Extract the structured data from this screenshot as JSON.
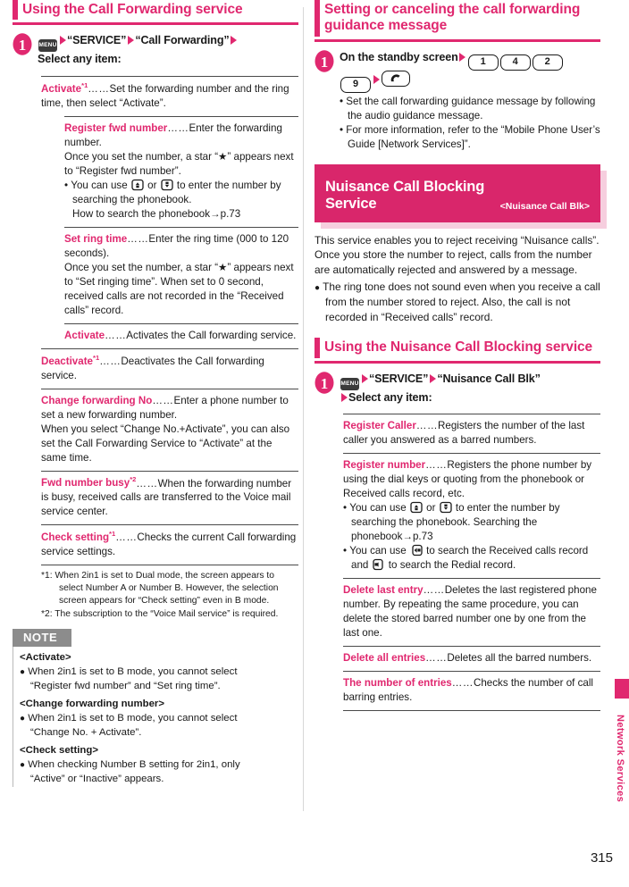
{
  "page": {
    "number": "315",
    "side_tab_label": "Network Services"
  },
  "left_column": {
    "section_heading": "Using the Call Forwarding service",
    "step": {
      "number_icon": "circled-number-1",
      "menu_key": "MENU",
      "text_parts": [
        "“SERVICE”",
        "“Call Forwarding”",
        "Select any item:"
      ]
    },
    "items": [
      {
        "term": "Activate",
        "sup": "*1",
        "body": "Set the forwarding number and the ring time, then select “Activate”."
      },
      {
        "sub": true,
        "term": "Register fwd number",
        "body": "Enter the forwarding number.",
        "lines": [
          "Once you set the number, a star “★” appears next to “Register fwd number”."
        ],
        "bullets": [
          {
            "pre": "You can use ",
            "mid": " or ",
            "post": " to enter the number by searching the phonebook.",
            "cont": "How to search the phonebook→p.73",
            "icon1": "phonebook-up-key-icon",
            "icon2": "phonebook-down-key-icon"
          }
        ]
      },
      {
        "sub": true,
        "term": "Set ring time",
        "body": "Enter the ring time (000 to 120 seconds).",
        "lines": [
          "Once you set the number, a star “★” appears next to “Set ringing time”. When set to 0 second, received calls are not recorded in the “Received calls” record."
        ]
      },
      {
        "sub": true,
        "term": "Activate",
        "body": "Activates the Call forwarding service."
      },
      {
        "term": "Deactivate",
        "sup": "*1",
        "body": "Deactivates the Call forwarding service."
      },
      {
        "term": "Change forwarding No",
        "body": "Enter a phone number to set a new forwarding number.",
        "lines": [
          "When you select “Change No.+Activate”, you can also set the Call Forwarding Service to “Activate” at the same time."
        ]
      },
      {
        "term": "Fwd number busy",
        "sup": "*2",
        "body": "When the forwarding number is busy, received calls are transferred to the Voice mail service center."
      },
      {
        "term": "Check setting",
        "sup": "*1",
        "body": "Checks the current Call forwarding service settings."
      }
    ],
    "footnotes": [
      "*1: When 2in1 is set to Dual mode, the screen appears to select Number A or Number B. However, the selection screen appears for “Check setting” even in B mode.",
      "*2: The subscription to the “Voice Mail service” is required."
    ],
    "note": {
      "label": "NOTE",
      "groups": [
        {
          "heading": "<Activate>",
          "bullet": "When 2in1 is set to B mode, you cannot select",
          "cont": "“Register fwd number” and “Set ring time”."
        },
        {
          "heading": "<Change forwarding number>",
          "bullet": "When 2in1 is set to B mode, you cannot select",
          "cont": "“Change No. + Activate”."
        },
        {
          "heading": "<Check setting>",
          "bullet": "When checking Number B setting for 2in1, only",
          "cont": "“Active” or “Inactive” appears."
        }
      ]
    }
  },
  "right_column": {
    "section_heading": "Setting or canceling the call forwarding guidance message",
    "step": {
      "number_icon": "circled-number-1",
      "lead": "On the standby screen",
      "keys": [
        "1",
        "4",
        "2",
        "9"
      ],
      "call_key": "call-key-icon"
    },
    "step_bullets": [
      "Set the call forwarding guidance message by following the audio guidance message.",
      "For more information, refer to the “Mobile Phone User’s Guide [Network Services]”."
    ],
    "block_head": {
      "title": "Nuisance Call Blocking Service",
      "subtitle": "<Nuisance Call Blk>"
    },
    "intro": "This service enables you to reject receiving “Nuisance calls”. Once you store the number to reject, calls from the number are automatically rejected and answered by a message.",
    "intro_bullet": "The ring tone does not sound even when you receive a call from the number stored to reject. Also, the call is not recorded in “Received calls” record.",
    "section_heading2": "Using the Nuisance Call Blocking service",
    "step2": {
      "number_icon": "circled-number-1",
      "menu_key": "MENU",
      "text_parts": [
        "“SERVICE”",
        "“Nuisance Call Blk”",
        "Select any item:"
      ]
    },
    "items": [
      {
        "term": "Register Caller",
        "body": "Registers the number of the last caller you answered as a barred numbers."
      },
      {
        "term": "Register number",
        "body": "Registers the phone number by using the dial keys or quoting from the phonebook or Received calls record, etc.",
        "bullets": [
          {
            "pre": "You can use ",
            "mid": " or ",
            "post": " to enter the number by searching the phonebook. Searching the",
            "cont": "phonebook→p.73",
            "icon1": "phonebook-up-key-icon",
            "icon2": "phonebook-down-key-icon"
          },
          {
            "pre": "You can use ",
            "mid": " to search the Received calls record and ",
            "post": " to search the Redial record.",
            "icon1": "received-calls-key-icon",
            "icon2": "redial-key-icon"
          }
        ]
      },
      {
        "term": "Delete last entry",
        "body": "Deletes the last registered phone number. By repeating the same procedure, you can delete the stored barred number one by one from the last one."
      },
      {
        "term": "Delete all entries",
        "body": "Deletes all the barred numbers."
      },
      {
        "term": "The number of entries",
        "body": "Checks the number of call barring entries."
      }
    ]
  },
  "dots": "……",
  "colors": {
    "magenta": "#e0286f",
    "block_pink": "#d9266b",
    "shadow_pink": "#f6cede",
    "note_gray": "#8c8c8c"
  }
}
